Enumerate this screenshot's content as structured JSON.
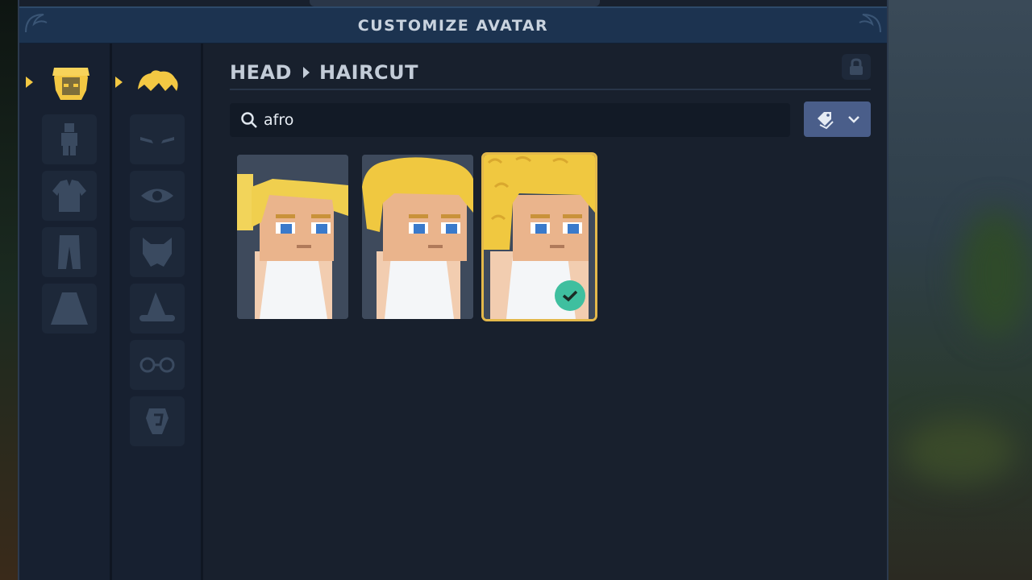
{
  "window": {
    "title": "CUSTOMIZE AVATAR"
  },
  "breadcrumb": {
    "category": "HEAD",
    "subcategory": "HAIRCUT"
  },
  "search": {
    "value": "afro",
    "icon": "search-icon"
  },
  "filter": {
    "icons": [
      "tag-icon",
      "chevron-down-icon"
    ]
  },
  "category_tabs": [
    {
      "name": "head",
      "icon": "head-icon",
      "active": true
    },
    {
      "name": "body",
      "icon": "body-icon",
      "active": false
    },
    {
      "name": "top",
      "icon": "jacket-icon",
      "active": false
    },
    {
      "name": "bottom",
      "icon": "pants-icon",
      "active": false
    },
    {
      "name": "cape",
      "icon": "cape-icon",
      "active": false
    }
  ],
  "subcategory_tabs": [
    {
      "name": "haircut",
      "icon": "hair-icon",
      "active": true
    },
    {
      "name": "eyebrows",
      "icon": "eyebrows-icon",
      "active": false
    },
    {
      "name": "eyes",
      "icon": "eye-icon",
      "active": false
    },
    {
      "name": "beard",
      "icon": "beard-icon",
      "active": false
    },
    {
      "name": "hat",
      "icon": "hat-icon",
      "active": false
    },
    {
      "name": "glasses",
      "icon": "glasses-icon",
      "active": false
    },
    {
      "name": "ears",
      "icon": "ear-icon",
      "active": false
    }
  ],
  "results": [
    {
      "name": "haircut-option-1",
      "selected": false
    },
    {
      "name": "haircut-option-2",
      "selected": false
    },
    {
      "name": "haircut-option-3",
      "selected": true
    }
  ],
  "colors": {
    "accent": "#f3c843",
    "selected_border": "#e3b84a",
    "check": "#3fbf9f",
    "panel": "#18202d",
    "titlebar": "#1c3350"
  }
}
